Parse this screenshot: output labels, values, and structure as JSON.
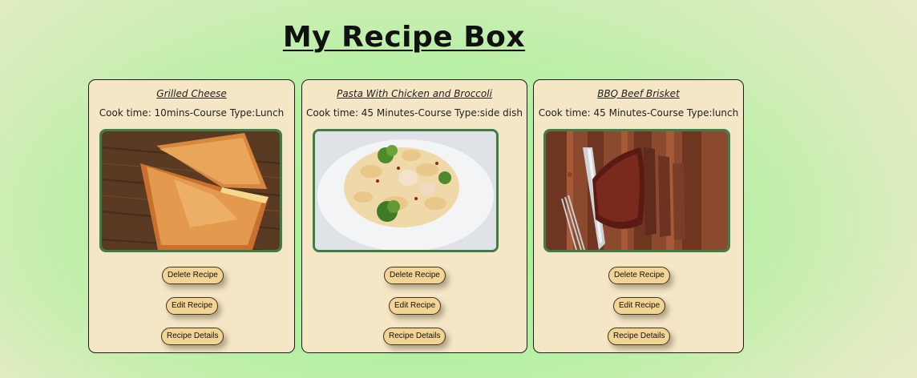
{
  "page": {
    "title": "My Recipe Box"
  },
  "recipes": [
    {
      "name": "Grilled Cheese",
      "meta": "Cook time: 10mins-Course Type:Lunch",
      "image": "grilled-cheese-photo",
      "buttons": {
        "delete": "Delete Recipe",
        "edit": "Edit Recipe",
        "details": "Recipe Details"
      }
    },
    {
      "name": "Pasta With Chicken and Broccoli",
      "meta": "Cook time: 45 Minutes-Course Type:side dish",
      "image": "pasta-chicken-broccoli-photo",
      "buttons": {
        "delete": "Delete Recipe",
        "edit": "Edit Recipe",
        "details": "Recipe Details"
      }
    },
    {
      "name": "BBQ Beef Brisket",
      "meta": "Cook time: 45 Minutes-Course Type:lunch",
      "image": "bbq-beef-brisket-photo",
      "buttons": {
        "delete": "Delete Recipe",
        "edit": "Edit Recipe",
        "details": "Recipe Details"
      }
    }
  ],
  "colors": {
    "card_background": "#f5e6c6",
    "image_border": "#3f7d48",
    "button_background": "#f2d494",
    "page_background": "#b6f0a4"
  }
}
